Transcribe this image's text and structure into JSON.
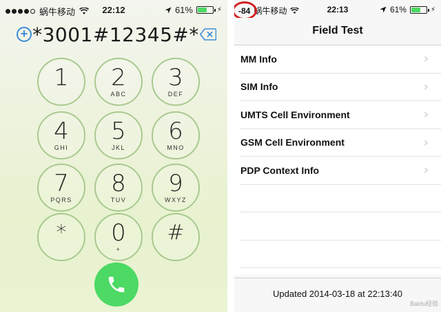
{
  "left_phone": {
    "status_bar": {
      "signal_bars": 5,
      "signal_filled": 4,
      "carrier": "蜗牛移动",
      "time": "22:12",
      "battery": "61%",
      "battery_level": 0.61
    },
    "dial_display": {
      "number": "*3001#12345#*"
    },
    "keypad": [
      {
        "digit": "1",
        "letters": ""
      },
      {
        "digit": "2",
        "letters": "ABC"
      },
      {
        "digit": "3",
        "letters": "DEF"
      },
      {
        "digit": "4",
        "letters": "GHI"
      },
      {
        "digit": "5",
        "letters": "JKL"
      },
      {
        "digit": "6",
        "letters": "MNO"
      },
      {
        "digit": "7",
        "letters": "PQRS"
      },
      {
        "digit": "8",
        "letters": "TUV"
      },
      {
        "digit": "9",
        "letters": "WXYZ"
      },
      {
        "digit": "*",
        "letters": ""
      },
      {
        "digit": "0",
        "letters": "+"
      },
      {
        "digit": "#",
        "letters": ""
      }
    ],
    "colors": {
      "call_green": "#4cd964",
      "key_ring": "#a9c98f",
      "accent_blue": "#3b8bd6"
    }
  },
  "right_phone": {
    "status_bar": {
      "signal_strength": "-84",
      "carrier": "蜗牛移动",
      "time": "22:13",
      "battery": "61%",
      "battery_level": 0.61
    },
    "title": "Field Test",
    "items": [
      {
        "label": "MM Info"
      },
      {
        "label": "SIM Info"
      },
      {
        "label": "UMTS Cell Environment"
      },
      {
        "label": "GSM Cell Environment"
      },
      {
        "label": "PDP Context Info"
      }
    ],
    "footer": "Updated 2014-03-18 at 22:13:40",
    "watermark": "Baidu经验",
    "colors": {
      "highlight": "#d21f1f"
    }
  }
}
